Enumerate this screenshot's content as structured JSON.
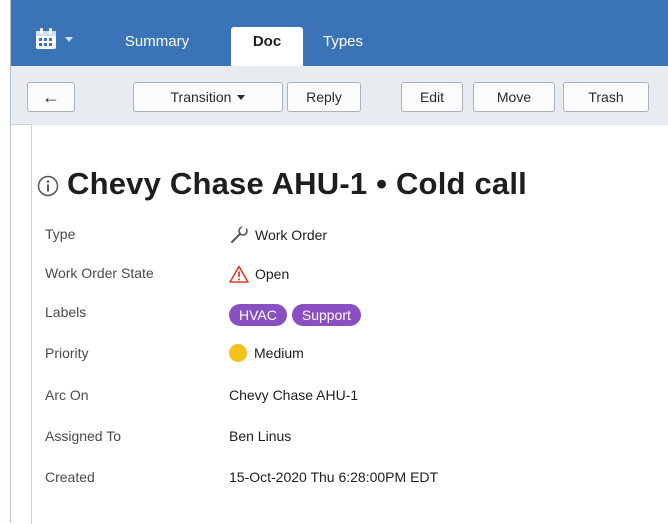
{
  "header": {
    "tabs": [
      {
        "label": "Summary"
      },
      {
        "label": "Doc"
      },
      {
        "label": "Types"
      }
    ],
    "active_tab": "Doc"
  },
  "toolbar": {
    "back_glyph": "←",
    "transition_label": "Transition",
    "reply_label": "Reply",
    "edit_label": "Edit",
    "move_label": "Move",
    "trash_label": "Trash"
  },
  "document": {
    "title_icon": "info-icon",
    "title": "Chevy Chase AHU-1 • Cold call",
    "fields": [
      {
        "label": "Type",
        "value": "Work Order",
        "icon": "wrench-icon"
      },
      {
        "label": "Work Order State",
        "value": "Open",
        "icon": "warning-icon"
      },
      {
        "label": "Labels",
        "tags": [
          "HVAC",
          "Support"
        ]
      },
      {
        "label": "Priority",
        "value": "Medium",
        "icon": "priority-dot-icon"
      },
      {
        "label": "Arc On",
        "value": "Chevy Chase AHU-1"
      },
      {
        "label": "Assigned To",
        "value": "Ben Linus"
      },
      {
        "label": "Created",
        "value": "15-Oct-2020 Thu 6:28:00PM EDT"
      }
    ]
  },
  "colors": {
    "header_bg": "#3a73b6",
    "toolbar_bg": "#e8ecf1",
    "tag_bg": "#8a4fc0",
    "warning": "#e03b2f",
    "priority_medium": "#f5c21b"
  }
}
